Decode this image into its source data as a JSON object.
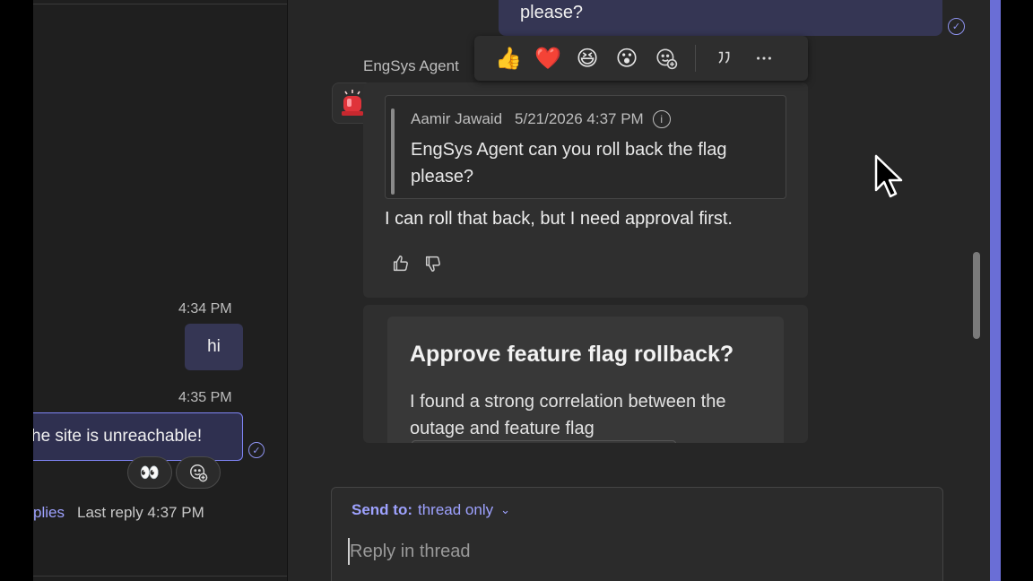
{
  "left_pane": {
    "msg1_time": "4:34 PM",
    "msg1_text": "hi",
    "msg2_time": "4:35 PM",
    "msg2_text": "he site is unreachable!",
    "reaction_emoji": "👀",
    "replies_label": "plies",
    "last_reply": "Last reply 4:37 PM"
  },
  "thread": {
    "top_bubble_text": "please?",
    "sender": "EngSys Agent",
    "reactions": [
      "👍",
      "❤️",
      "😆",
      "😮"
    ],
    "quote": {
      "author": "Aamir Jawaid",
      "timestamp": "5/21/2026 4:37 PM",
      "text": "EngSys Agent can you roll back the flag please?"
    },
    "reply_text": "I can roll that back, but I need approval first.",
    "approval_card": {
      "title": "Approve feature flag rollback?",
      "body": "I found a strong correlation between the outage and feature flag"
    }
  },
  "composer": {
    "send_to_label": "Send to:",
    "send_to_value": "thread only",
    "placeholder": "Reply in thread"
  },
  "colors": {
    "accent": "#7f85f5",
    "bubble": "#353654",
    "background": "#262626"
  }
}
